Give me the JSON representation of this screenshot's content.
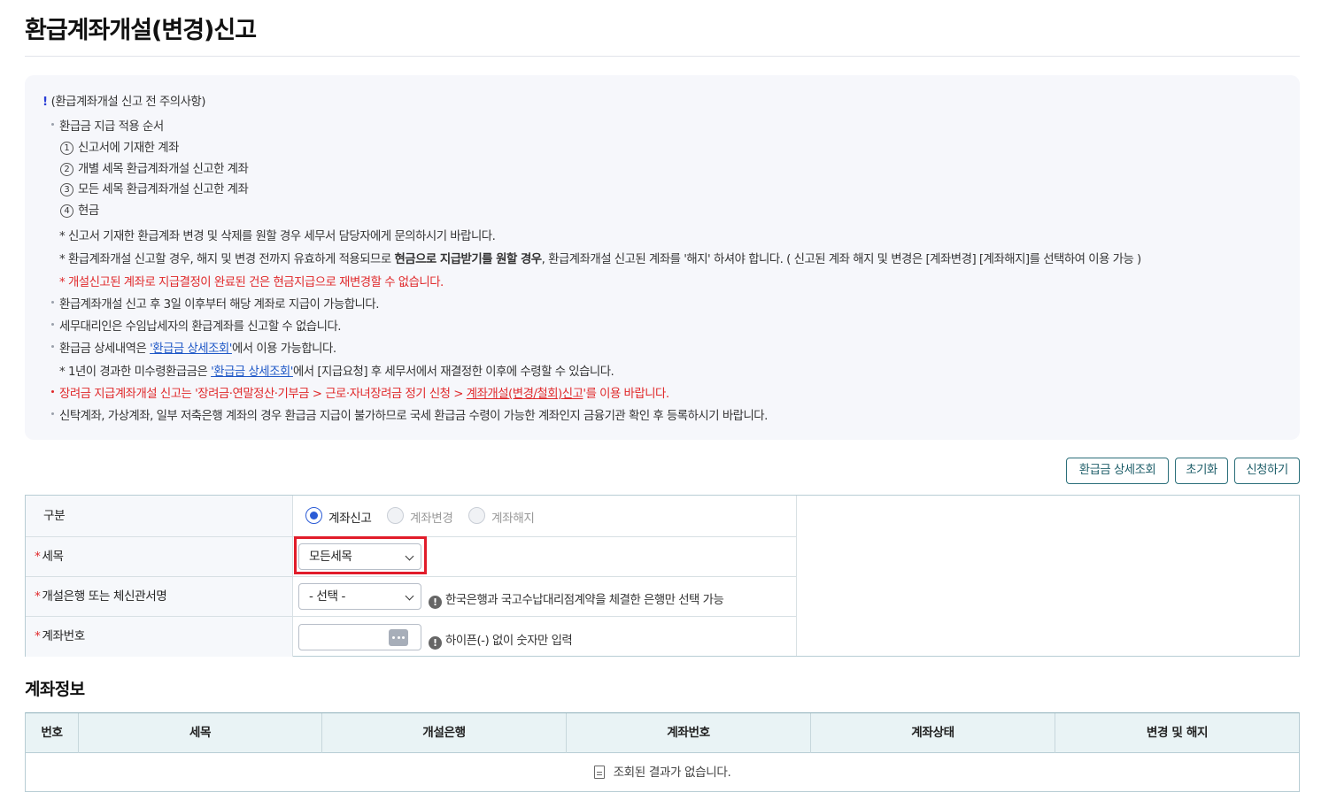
{
  "page": {
    "title": "환급계좌개설(변경)신고"
  },
  "notice": {
    "heading": "(환급계좌개설 신고 전 주의사항)",
    "order_title": "환급금 지급 적용 순서",
    "order_items": [
      {
        "num": "1",
        "text": "신고서에 기재한 계좌"
      },
      {
        "num": "2",
        "text": "개별 세목 환급계좌개설 신고한 계좌"
      },
      {
        "num": "3",
        "text": "모든 세목 환급계좌개설 신고한 계좌"
      },
      {
        "num": "4",
        "text": "현금"
      }
    ],
    "note1": "* 신고서 기재한 환급계좌 변경 및 삭제를 원할 경우 세무서 담당자에게 문의하시기 바랍니다.",
    "note2_a": "* 환급계좌개설 신고할 경우, 해지 및 변경 전까지 유효하게 적용되므로 ",
    "note2_b": "현금으로 지급받기를 원할 경우",
    "note2_c": ", 환급계좌개설 신고된 계좌를 '해지' 하셔야 합니다. ( 신고된 계좌 해지 및 변경은 [계좌변경] [계좌해지]를 선택하여 이용 가능 )",
    "note3": "* 개설신고된 계좌로 지급결정이 완료된 건은 현금지급으로 재변경할 수 없습니다.",
    "bullet2": "환급계좌개설 신고 후 3일 이후부터 해당 계좌로 지급이 가능합니다.",
    "bullet3": "세무대리인은 수임납세자의 환급계좌를 신고할 수 없습니다.",
    "bullet4_a": "환급금 상세내역은 ",
    "bullet4_link": "'환급금 상세조회'",
    "bullet4_b": "에서 이용 가능합니다.",
    "note4_a": "* 1년이 경과한 미수령환급금은 ",
    "note4_link": "'환급금 상세조회'",
    "note4_b": "에서 [지급요청] 후 세무서에서 재결정한 이후에 수령할 수 있습니다.",
    "bullet5_a": "장려금 지급계좌개설 신고는 '장려금·연말정산·기부금 > 근로·자녀장려금 정기 신청 > ",
    "bullet5_link": "계좌개설(변경/철회)신고",
    "bullet5_b": "'를 이용 바랍니다.",
    "bullet6": "신탁계좌, 가상계좌, 일부 저축은행 계좌의 경우 환급금 지급이 불가하므로 국세 환급금 수령이 가능한 계좌인지 금융기관 확인 후 등록하시기 바랍니다."
  },
  "toolbar": {
    "detail_button": "환급금 상세조회",
    "reset_button": "초기화",
    "apply_button": "신청하기"
  },
  "form": {
    "type_label": "구분",
    "type_options": [
      "계좌신고",
      "계좌변경",
      "계좌해지"
    ],
    "type_selected": "계좌신고",
    "tax_label": "세목",
    "tax_value": "모든세목",
    "bank_label": "개설은행 또는 체신관서명",
    "bank_value": "- 선택 -",
    "bank_hint": "한국은행과 국고수납대리점계약을 체결한 은행만 선택 가능",
    "account_label": "계좌번호",
    "account_value": "",
    "account_hint": "하이픈(-) 없이 숫자만 입력"
  },
  "account_info": {
    "title": "계좌정보",
    "columns": [
      "번호",
      "세목",
      "개설은행",
      "계좌번호",
      "계좌상태",
      "변경 및 해지"
    ],
    "empty_message": "조회된 결과가 없습니다."
  },
  "colors": {
    "accent": "#2b5cd6",
    "required": "#e0282a",
    "highlight": "#e11c2a",
    "button_border": "#2b6f7a"
  }
}
